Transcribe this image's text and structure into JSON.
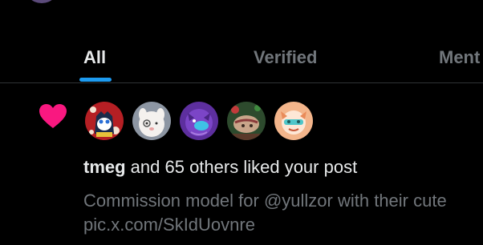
{
  "tabs": [
    {
      "label": "All",
      "active": true
    },
    {
      "label": "Verified",
      "active": false
    },
    {
      "label": "Ment",
      "active": false
    }
  ],
  "accent_color": "#1d9bf0",
  "like_color": "#f91880",
  "notification": {
    "icon": "heart-icon",
    "avatars": [
      "avatar-1",
      "avatar-2",
      "avatar-3",
      "avatar-4",
      "avatar-5"
    ],
    "username": "tmeg",
    "action_text": " and 65 others liked your post",
    "post_text_line1": "Commission model for @yullzor with their cute",
    "post_text_line2": "pic.x.com/SkIdUovnre"
  }
}
